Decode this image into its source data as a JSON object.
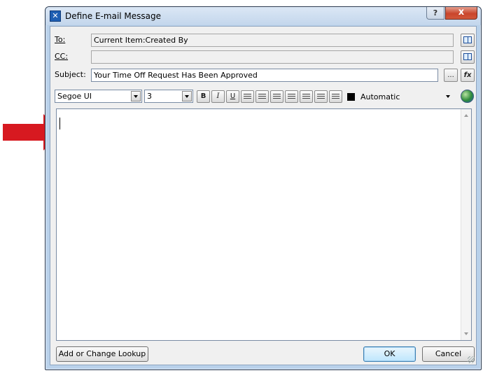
{
  "window": {
    "title": "Define E-mail Message",
    "help_label": "?",
    "close_label": "x"
  },
  "fields": {
    "to_label": "To:",
    "to_value": "Current Item:Created By",
    "cc_label": "CC:",
    "cc_value": "",
    "subject_label": "Subject:",
    "subject_value": "Your Time Off Request Has Been Approved",
    "ellipsis_label": "...",
    "fx_label": "fx"
  },
  "toolbar": {
    "font_name": "Segoe UI",
    "font_size": "3",
    "bold_label": "B",
    "italic_label": "I",
    "underline_label": "U",
    "color_name": "Automatic",
    "color_swatch": "#000000"
  },
  "body": {
    "text": ""
  },
  "buttons": {
    "lookup_label": "Add or Change Lookup",
    "ok_label": "OK",
    "cancel_label": "Cancel"
  },
  "colors": {
    "arrow": "#d71920",
    "frame": "#b9d1ea"
  }
}
